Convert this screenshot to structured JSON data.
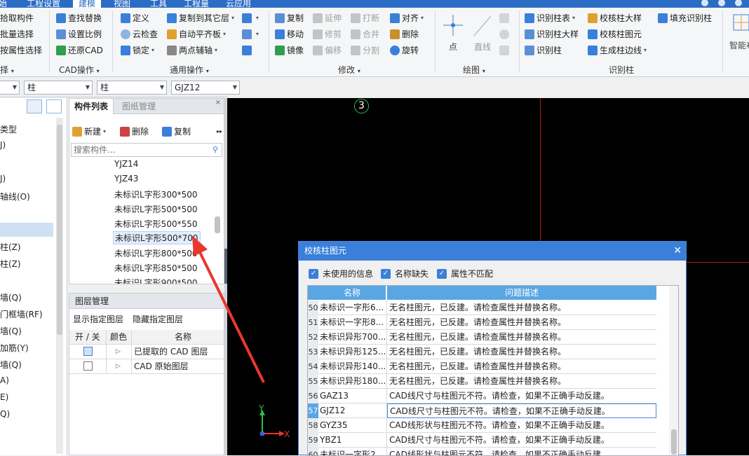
{
  "menubar": {
    "items": [
      "始",
      "工程设置",
      "建模",
      "视图",
      "工具",
      "工程量",
      "云应用"
    ],
    "active": "建模"
  },
  "ribbon": {
    "select_group": {
      "items": [
        "拾取构件",
        "批量选择",
        "按属性选择"
      ],
      "label": "择"
    },
    "cad_group": {
      "items": [
        "查找替换",
        "设置比例",
        "还原CAD"
      ],
      "label": "CAD操作"
    },
    "common_group": {
      "items": [
        "定义",
        "复制到其它层",
        "云检查",
        "自动平齐板",
        "锁定",
        "两点辅轴"
      ],
      "label": "通用操作"
    },
    "modify_group": {
      "items": [
        "复制",
        "延伸",
        "打断",
        "对齐",
        "移动",
        "修剪",
        "合并",
        "删除",
        "镜像",
        "偏移",
        "分割",
        "旋转"
      ],
      "label": "修改"
    },
    "draw_group": {
      "items": [
        "点",
        "直线"
      ],
      "label": "绘图"
    },
    "recognize_group": {
      "items": [
        "识别柱表",
        "校核柱大样",
        "填充识别柱",
        "识别柱大样",
        "校核柱图元",
        "识别柱",
        "生成柱边线"
      ],
      "label": "识别柱"
    },
    "smart_label": "智能布"
  },
  "filters": {
    "combo1": "",
    "combo2": "柱",
    "combo3": "柱",
    "combo4": "GJZ12"
  },
  "left_tree": {
    "items": [
      "类型",
      "J)",
      "J)",
      "轴线(O)",
      "柱(Z)",
      "柱(Z)",
      "墙(Q)",
      "门框墙(RF)",
      "墙(Q)",
      "加筋(Y)",
      "墙(Q)",
      "A)",
      "E)",
      "Q)"
    ]
  },
  "component_panel": {
    "tab_list": "构件列表",
    "tab_drawing": "图纸管理",
    "new_label": "新建",
    "delete_label": "删除",
    "copy_label": "复制",
    "search_placeholder": "搜索构件...",
    "items": [
      "YJZ14",
      "YJZ43",
      "未标识L字形300*500",
      "未标识L字形500*500",
      "未标识L字形500*550",
      "未标识L字形500*700",
      "未标识L字形800*500",
      "未标识L字形850*500",
      "未标识L字形900*500"
    ],
    "selected_index": 5
  },
  "layer_panel": {
    "title": "图层管理",
    "show_label": "显示指定图层",
    "hide_label": "隐藏指定图层",
    "col_toggle": "开 / 关",
    "col_color": "颜色",
    "col_name": "名称",
    "rows": [
      {
        "name": "已提取的 CAD 图层",
        "on": true
      },
      {
        "name": "CAD 原始图层",
        "on": false
      }
    ]
  },
  "canvas": {
    "axis_label": "3",
    "ucs_y": "Y",
    "ucs_x": "X"
  },
  "dialog": {
    "title": "校核柱图元",
    "options": [
      "未使用的信息",
      "名称缺失",
      "属性不匹配"
    ],
    "col_name": "名称",
    "col_desc": "问题描述",
    "rows": [
      {
        "num": "50",
        "name": "未标识一字形6...",
        "desc": "无名柱图元，已反建。请检查属性并替换名称。"
      },
      {
        "num": "51",
        "name": "未标识一字形8...",
        "desc": "无名柱图元，已反建。请检查属性并替换名称。"
      },
      {
        "num": "52",
        "name": "未标识异形700...",
        "desc": "无名柱图元，已反建。请检查属性并替换名称。"
      },
      {
        "num": "53",
        "name": "未标识异形125...",
        "desc": "无名柱图元，已反建。请检查属性并替换名称。"
      },
      {
        "num": "54",
        "name": "未标识异形140...",
        "desc": "无名柱图元，已反建。请检查属性并替换名称。"
      },
      {
        "num": "55",
        "name": "未标识异形180...",
        "desc": "无名柱图元，已反建。请检查属性并替换名称。"
      },
      {
        "num": "56",
        "name": "GAZ13",
        "desc": "CAD线尺寸与柱图元不符。请检查，如果不正确手动反建。"
      },
      {
        "num": "57",
        "name": "GJZ12",
        "desc": "CAD线尺寸与柱图元不符。请检查，如果不正确手动反建。"
      },
      {
        "num": "58",
        "name": "GYZ35",
        "desc": "CAD线形状与柱图元不符。请检查，如果不正确手动反建。"
      },
      {
        "num": "59",
        "name": "YBZ1",
        "desc": "CAD线尺寸与柱图元不符。请检查，如果不正确手动反建。"
      },
      {
        "num": "60",
        "name": "未标识一字形2...",
        "desc": "CAD线形状与柱图元不符。请检查，如果不正确手动反建。"
      }
    ],
    "selected_num": "57"
  },
  "colors": {
    "accent": "#3a7fd9",
    "grid_header": "#5aa6e3",
    "annotation_arrow": "#e8382e",
    "canvas_line": "#c0141e",
    "axis_circle": "#2fbf4a"
  }
}
